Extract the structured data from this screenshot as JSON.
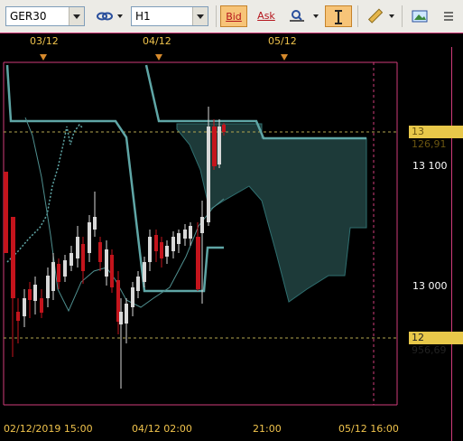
{
  "toolbar": {
    "symbol": "GER30",
    "timeframe": "H1",
    "bid_label": "Bid",
    "ask_label": "Ask"
  },
  "top_dates": [
    {
      "label": "03/12"
    },
    {
      "label": "04/12"
    },
    {
      "label": "05/12"
    }
  ],
  "price_axis": {
    "ticks": [
      "13 100",
      "13 000"
    ],
    "current_price": "13 126,91",
    "level_price": "12 956,69"
  },
  "time_axis": [
    "02/12/2019 15:00",
    "04/12 02:00",
    "21:00",
    "05/12 16:00"
  ],
  "colors": {
    "border": "#d13b7a",
    "bull_candle": "#d8d8d8",
    "bear_candle": "#c4141c",
    "kijun": "#5fa6a6",
    "cloud": "#1d3a39",
    "dotted": "#f0c34c",
    "price_box": "#e8c84a"
  }
}
